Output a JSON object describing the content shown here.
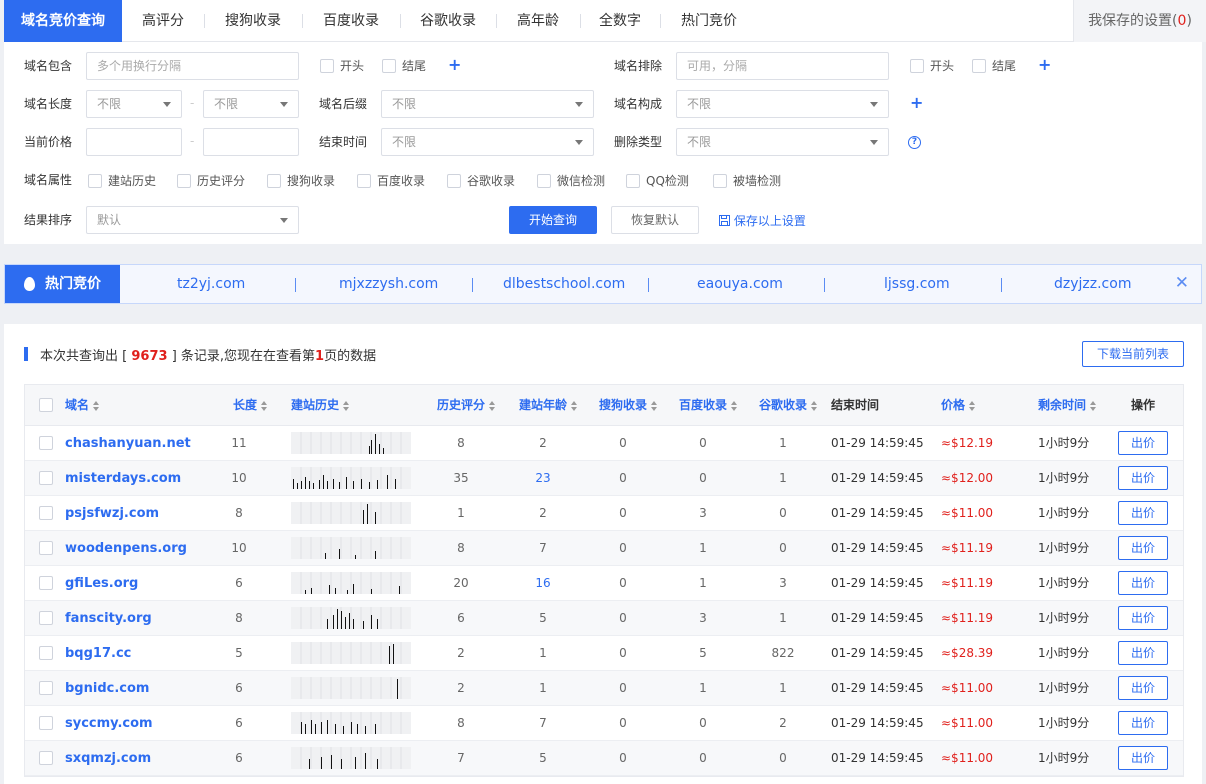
{
  "nav": {
    "tabs": [
      "域名竞价查询",
      "高评分",
      "搜狗收录",
      "百度收录",
      "谷歌收录",
      "高年龄",
      "全数字",
      "热门竞价"
    ],
    "saved_label": "我保存的设置(",
    "saved_count": "0",
    "saved_close": ")"
  },
  "filters": {
    "contain_label": "域名包含",
    "contain_placeholder": "多个用换行分隔",
    "start_label": "开头",
    "end_label": "结尾",
    "exclude_label": "域名排除",
    "exclude_placeholder": "可用，分隔",
    "length_label": "域名长度",
    "length_min": "不限",
    "length_max": "不限",
    "suffix_label": "域名后缀",
    "suffix_value": "不限",
    "compose_label": "域名构成",
    "compose_value": "不限",
    "price_label": "当前价格",
    "endtime_label": "结束时间",
    "endtime_value": "不限",
    "deltype_label": "删除类型",
    "deltype_value": "不限",
    "attr_label": "域名属性",
    "attrs": [
      "建站历史",
      "历史评分",
      "搜狗收录",
      "百度收录",
      "谷歌收录",
      "微信检测",
      "QQ检测",
      "被墙检测"
    ],
    "sort_label": "结果排序",
    "sort_value": "默认",
    "search_button": "开始查询",
    "reset_button": "恢复默认",
    "save_link": "保存以上设置"
  },
  "hot": {
    "label": "热门竞价",
    "domains": [
      "tz2yj.com",
      "mjxzzysh.com",
      "dlbestschool.com",
      "eaouya.com",
      "ljssg.com",
      "dzyjzz.com"
    ]
  },
  "results": {
    "summary_pre": "本次共查询出 [",
    "total": "9673",
    "summary_mid": "] 条记录,您现在在查看第",
    "page": "1",
    "summary_post": "页的数据",
    "download": "下载当前列表",
    "headers": [
      "域名",
      "长度",
      "建站历史",
      "历史评分",
      "建站年龄",
      "搜狗收录",
      "百度收录",
      "谷歌收录",
      "结束时间",
      "价格",
      "剩余时间",
      "操作"
    ],
    "bid_label": "出价",
    "rows": [
      {
        "domain": "chashanyuan.net",
        "length": "11",
        "hscore": "8",
        "age": "2",
        "sogou": "0",
        "baidu": "0",
        "google": "1",
        "end": "01-29 14:59:45",
        "price": "≈$12.19",
        "remain": "1小时9分",
        "age_hl": false
      },
      {
        "domain": "misterdays.com",
        "length": "10",
        "hscore": "35",
        "age": "23",
        "sogou": "0",
        "baidu": "0",
        "google": "1",
        "end": "01-29 14:59:45",
        "price": "≈$12.00",
        "remain": "1小时9分",
        "age_hl": true
      },
      {
        "domain": "psjsfwzj.com",
        "length": "8",
        "hscore": "1",
        "age": "2",
        "sogou": "0",
        "baidu": "3",
        "google": "0",
        "end": "01-29 14:59:45",
        "price": "≈$11.00",
        "remain": "1小时9分",
        "age_hl": false
      },
      {
        "domain": "woodenpens.org",
        "length": "10",
        "hscore": "8",
        "age": "7",
        "sogou": "0",
        "baidu": "1",
        "google": "0",
        "end": "01-29 14:59:45",
        "price": "≈$11.19",
        "remain": "1小时9分",
        "age_hl": false
      },
      {
        "domain": "gfiLes.org",
        "length": "6",
        "hscore": "20",
        "age": "16",
        "sogou": "0",
        "baidu": "1",
        "google": "3",
        "end": "01-29 14:59:45",
        "price": "≈$11.19",
        "remain": "1小时9分",
        "age_hl": true
      },
      {
        "domain": "fanscity.org",
        "length": "8",
        "hscore": "6",
        "age": "5",
        "sogou": "0",
        "baidu": "3",
        "google": "1",
        "end": "01-29 14:59:45",
        "price": "≈$11.19",
        "remain": "1小时9分",
        "age_hl": false
      },
      {
        "domain": "bqg17.cc",
        "length": "5",
        "hscore": "2",
        "age": "1",
        "sogou": "0",
        "baidu": "5",
        "google": "822",
        "end": "01-29 14:59:45",
        "price": "≈$28.39",
        "remain": "1小时9分",
        "age_hl": false
      },
      {
        "domain": "bgnidc.com",
        "length": "6",
        "hscore": "2",
        "age": "1",
        "sogou": "0",
        "baidu": "1",
        "google": "1",
        "end": "01-29 14:59:45",
        "price": "≈$11.00",
        "remain": "1小时9分",
        "age_hl": false
      },
      {
        "domain": "syccmy.com",
        "length": "6",
        "hscore": "8",
        "age": "7",
        "sogou": "0",
        "baidu": "0",
        "google": "2",
        "end": "01-29 14:59:45",
        "price": "≈$11.00",
        "remain": "1小时9分",
        "age_hl": false
      },
      {
        "domain": "sxqmzj.com",
        "length": "6",
        "hscore": "7",
        "age": "5",
        "sogou": "0",
        "baidu": "0",
        "google": "0",
        "end": "01-29 14:59:45",
        "price": "≈$11.00",
        "remain": "1小时9分",
        "age_hl": false
      }
    ]
  }
}
